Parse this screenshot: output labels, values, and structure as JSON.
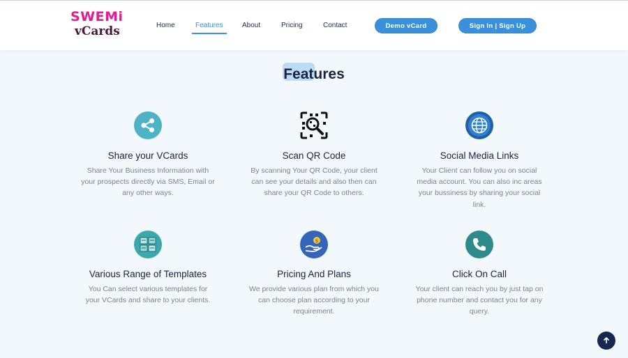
{
  "brand": {
    "line1": "SWEMi",
    "line2": "vCards"
  },
  "nav": [
    {
      "label": "Home"
    },
    {
      "label": "Features"
    },
    {
      "label": "About"
    },
    {
      "label": "Pricing"
    },
    {
      "label": "Contact"
    }
  ],
  "buttons": {
    "demo": "Demo vCard",
    "signin": "Sign In | Sign Up"
  },
  "section": {
    "title": "Features"
  },
  "features": [
    {
      "title": "Share your VCards",
      "icon": "share-icon",
      "color": "#4fb3c8",
      "desc": [
        "Share Your Business Information with",
        "your prospects directly via SMS, Email or",
        "any other ways."
      ]
    },
    {
      "title": "Scan QR Code",
      "icon": "qr-scan-icon",
      "color": "#111111",
      "desc": [
        "By scanning Your QR Code, your client",
        "can see your details and also then can",
        "share your QR Code to others."
      ]
    },
    {
      "title": "Social Media Links",
      "icon": "globe-icon",
      "color": "#2b78c4",
      "desc": [
        "Your Client can follow you on social",
        "media account. You can also inc areas",
        "your bussiness by sharing your social",
        "link."
      ]
    },
    {
      "title": "Various Range of Templates",
      "icon": "templates-icon",
      "color": "#3aa9ae",
      "desc": [
        "You Can select various templates for",
        "your VCards and share to your clients."
      ]
    },
    {
      "title": "Pricing And Plans",
      "icon": "pricing-icon",
      "color": "#3565b8",
      "desc": [
        "We provide various plan from which you",
        "can choose plan according to your",
        "requirement."
      ]
    },
    {
      "title": "Click On Call",
      "icon": "phone-icon",
      "color": "#2f8a8e",
      "desc": [
        "Your client can reach you by just tap on",
        "phone number and contact you for any",
        "query."
      ]
    }
  ],
  "scroll_top": {
    "icon": "arrow-up-icon"
  }
}
